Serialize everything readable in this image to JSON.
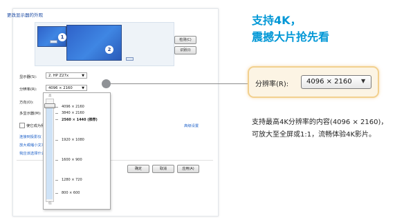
{
  "dialog": {
    "title": "更改显示器的外观",
    "monitors": [
      {
        "number": "1"
      },
      {
        "number": "2"
      }
    ],
    "detect_label": "检测(C)",
    "identify_label": "识别(I)",
    "display_label": "显示器(S):",
    "display_value": "2. HP Z27x",
    "resolution_label": "分辨率(R):",
    "resolution_value": "4096 × 2160",
    "orientation_label": "方向(O):",
    "multi_display_label": "多显示器(M):",
    "make_main_label": "使它成为我的",
    "advanced_link": "高级设置",
    "links": [
      "连接到投影仪",
      "放大或缩小文本",
      "我应该选择什么"
    ],
    "ok_label": "确定",
    "cancel_label": "取消",
    "apply_label": "应用(A)"
  },
  "dropdown": {
    "high_label": "高",
    "low_label": "低",
    "options": [
      {
        "label": "4096 × 2160",
        "selected": false
      },
      {
        "label": "3840 × 2160",
        "selected": false
      },
      {
        "label": "2560 × 1440 (推荐)",
        "selected": true
      },
      {
        "label": "1920 × 1080",
        "selected": false
      },
      {
        "label": "1600 × 900",
        "selected": false
      },
      {
        "label": "1280 × 720",
        "selected": false
      },
      {
        "label": "800 × 600",
        "selected": false
      }
    ],
    "slider_position": "top"
  },
  "callout": {
    "label": "分辨率(R):",
    "value": "4096 × 2160"
  },
  "headline": {
    "line1": "支持4K，",
    "line2": "震撼大片抢先看"
  },
  "description": {
    "line1": "支持最高4K分辨率的内容(4096 × 2160)，",
    "line2": "可放大至全屏或1:1，流畅体验4K影片。"
  },
  "colors": {
    "accent": "#0097d6",
    "callout_border": "#f2d08e",
    "link": "#1b5fc8",
    "monitor": "#3f86e3"
  }
}
